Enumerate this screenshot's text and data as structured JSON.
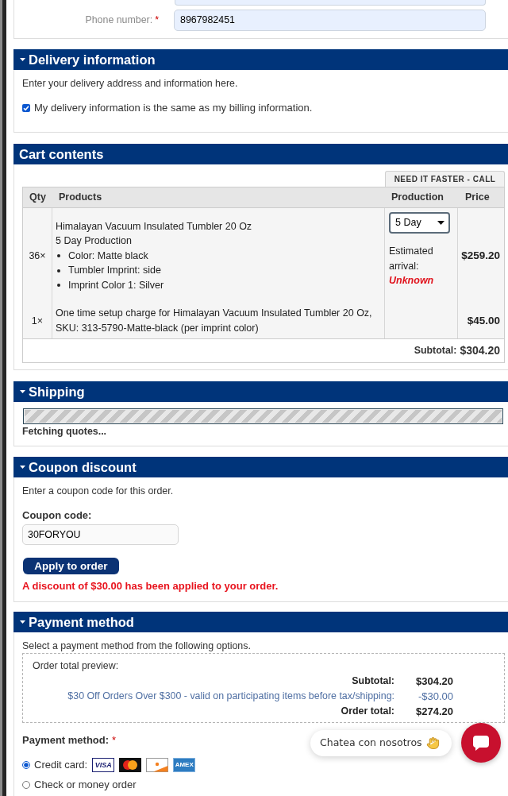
{
  "billing": {
    "phone": {
      "label": "Phone number:",
      "required_mark": "*",
      "value": "8967982451"
    }
  },
  "delivery": {
    "title": "Delivery information",
    "collapsible": true,
    "intro": "Enter your delivery address and information here.",
    "same_as_billing": {
      "label": "My delivery information is the same as my billing information.",
      "checked": true
    }
  },
  "cart": {
    "title": "Cart contents",
    "collapsible": false,
    "rush_notice": "NEED IT FASTER - CALL",
    "columns": [
      "Qty",
      "Products",
      "Production",
      "Price"
    ],
    "rows": [
      {
        "qty": "36×",
        "name": "Himalayan Vacuum Insulated Tumbler 20 Oz",
        "note": "5 Day Production",
        "options": [
          "Color: Matte black",
          "Tumbler Imprint: side",
          "Imprint Color 1: Silver"
        ],
        "production": {
          "value": "5 Day",
          "arrival_label": "Estimated arrival:",
          "arrival": "Unknown"
        },
        "price": "$259.20"
      },
      {
        "qty": "1×",
        "name": "One time setup charge for Himalayan Vacuum Insulated Tumbler 20 Oz, SKU: 313-5790-Matte-black (per imprint color)",
        "price": "$45.00"
      }
    ],
    "subtotal_label": "Subtotal:",
    "subtotal": "$304.20"
  },
  "shipping": {
    "title": "Shipping",
    "collapsible": true,
    "level": 1,
    "status": "Fetching quotes..."
  },
  "coupon": {
    "title": "Coupon discount",
    "collapsible": true,
    "intro": "Enter a coupon code for this order.",
    "field_label": "Coupon code:",
    "value": "30FORYOU",
    "button": "Apply to order",
    "message": "A discount of $30.00 has been applied to your order."
  },
  "payment": {
    "title": "Payment method",
    "collapsible": true,
    "intro": "Select a payment method from the following options.",
    "preview": {
      "title": "Order total preview:",
      "lines": [
        {
          "kind": "sum",
          "label": "Subtotal:",
          "value": "$304.20"
        },
        {
          "kind": "discount",
          "label": "$30 Off Orders Over $300 - valid on participating items before tax/shipping:",
          "value": "-$30.00"
        },
        {
          "kind": "sum",
          "label": "Order total:",
          "value": "$274.20"
        }
      ]
    },
    "method_label": "Payment method:",
    "required_mark": "*",
    "options": [
      {
        "label": "Credit card:",
        "selected": true,
        "cards": [
          {
            "kind": "visa",
            "label": "VISA"
          },
          {
            "kind": "mastercard"
          },
          {
            "kind": "discover"
          },
          {
            "kind": "amex",
            "label": "AMEX"
          }
        ]
      },
      {
        "label": "Check or money order",
        "selected": false
      }
    ]
  },
  "chat": {
    "label": "Chatea con nosotros"
  }
}
